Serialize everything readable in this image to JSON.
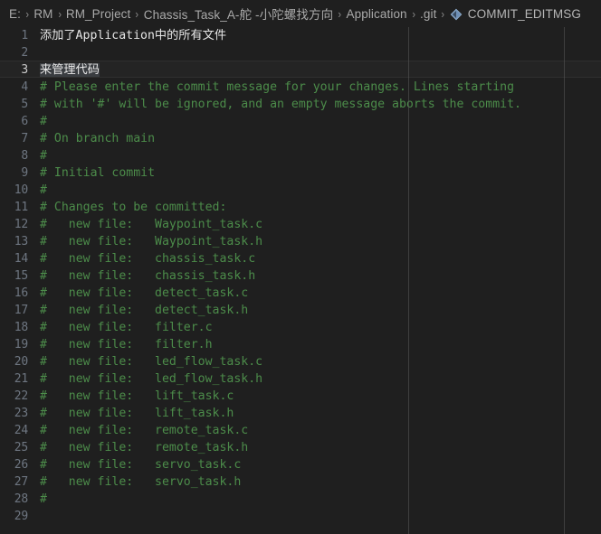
{
  "window": {
    "app": "vscode-editor",
    "background_color": "#1f1f1f"
  },
  "breadcrumb": {
    "separator": "›",
    "file_icon": "git-file-diamond-icon",
    "items": [
      {
        "label": "E:",
        "type": "drive"
      },
      {
        "label": "RM",
        "type": "folder"
      },
      {
        "label": "RM_Project",
        "type": "folder"
      },
      {
        "label": "Chassis_Task_A-舵 -小陀螺找方向",
        "type": "folder"
      },
      {
        "label": "Application",
        "type": "folder"
      },
      {
        "label": ".git",
        "type": "folder"
      },
      {
        "label": "COMMIT_EDITMSG",
        "type": "file"
      }
    ]
  },
  "editor": {
    "active_line": 3,
    "selection_text": "来管理代码",
    "ruler_columns": [
      50,
      72
    ],
    "comment_color": "#4c8c4a",
    "text_color": "#d4d4d4",
    "selection_color": "#3a3d41",
    "lines": [
      {
        "n": 1,
        "text": "添加了Application中的所有文件",
        "kind": "cjk"
      },
      {
        "n": 2,
        "text": "",
        "kind": "plain"
      },
      {
        "n": 3,
        "text": "来管理代码",
        "kind": "selected"
      },
      {
        "n": 4,
        "text": "# Please enter the commit message for your changes. Lines starting",
        "kind": "comment"
      },
      {
        "n": 5,
        "text": "# with '#' will be ignored, and an empty message aborts the commit.",
        "kind": "comment"
      },
      {
        "n": 6,
        "text": "#",
        "kind": "comment"
      },
      {
        "n": 7,
        "text": "# On branch main",
        "kind": "comment"
      },
      {
        "n": 8,
        "text": "#",
        "kind": "comment"
      },
      {
        "n": 9,
        "text": "# Initial commit",
        "kind": "comment"
      },
      {
        "n": 10,
        "text": "#",
        "kind": "comment"
      },
      {
        "n": 11,
        "text": "# Changes to be committed:",
        "kind": "comment"
      },
      {
        "n": 12,
        "text": "#\tnew file:   Waypoint_task.c",
        "kind": "comment"
      },
      {
        "n": 13,
        "text": "#\tnew file:   Waypoint_task.h",
        "kind": "comment"
      },
      {
        "n": 14,
        "text": "#\tnew file:   chassis_task.c",
        "kind": "comment"
      },
      {
        "n": 15,
        "text": "#\tnew file:   chassis_task.h",
        "kind": "comment"
      },
      {
        "n": 16,
        "text": "#\tnew file:   detect_task.c",
        "kind": "comment"
      },
      {
        "n": 17,
        "text": "#\tnew file:   detect_task.h",
        "kind": "comment"
      },
      {
        "n": 18,
        "text": "#\tnew file:   filter.c",
        "kind": "comment"
      },
      {
        "n": 19,
        "text": "#\tnew file:   filter.h",
        "kind": "comment"
      },
      {
        "n": 20,
        "text": "#\tnew file:   led_flow_task.c",
        "kind": "comment"
      },
      {
        "n": 21,
        "text": "#\tnew file:   led_flow_task.h",
        "kind": "comment"
      },
      {
        "n": 22,
        "text": "#\tnew file:   lift_task.c",
        "kind": "comment"
      },
      {
        "n": 23,
        "text": "#\tnew file:   lift_task.h",
        "kind": "comment"
      },
      {
        "n": 24,
        "text": "#\tnew file:   remote_task.c",
        "kind": "comment"
      },
      {
        "n": 25,
        "text": "#\tnew file:   remote_task.h",
        "kind": "comment"
      },
      {
        "n": 26,
        "text": "#\tnew file:   servo_task.c",
        "kind": "comment"
      },
      {
        "n": 27,
        "text": "#\tnew file:   servo_task.h",
        "kind": "comment"
      },
      {
        "n": 28,
        "text": "#",
        "kind": "comment"
      },
      {
        "n": 29,
        "text": "",
        "kind": "plain"
      }
    ]
  }
}
